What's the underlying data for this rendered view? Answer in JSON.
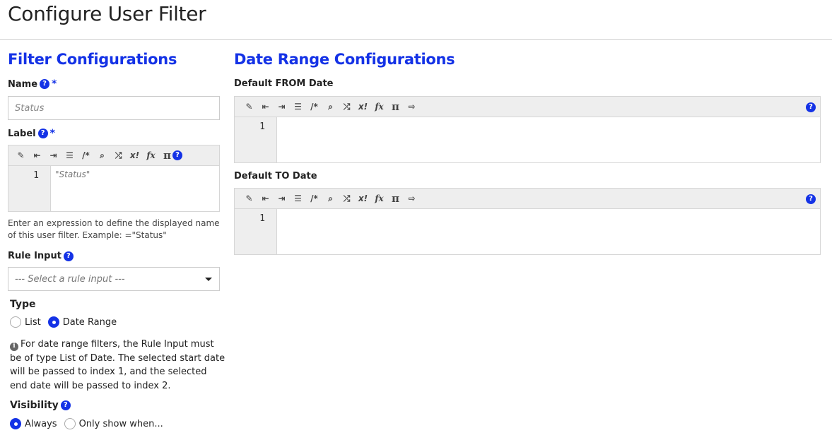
{
  "page": {
    "title": "Configure User Filter"
  },
  "filter_config": {
    "heading": "Filter Configurations",
    "name": {
      "label": "Name",
      "required_mark": "*",
      "placeholder": "Status",
      "value": ""
    },
    "label": {
      "label": "Label",
      "required_mark": "*",
      "line_number": "1",
      "code": "\"Status\"",
      "hint": "Enter an expression to define the displayed name of this user filter. Example: =\"Status\""
    },
    "rule_input": {
      "label": "Rule Input",
      "selected": "--- Select a rule input ---"
    },
    "type": {
      "label": "Type",
      "options": [
        {
          "label": "List",
          "selected": false
        },
        {
          "label": "Date Range",
          "selected": true
        }
      ],
      "info": "For date range filters, the Rule Input must be of type List of Date. The selected start date will be passed to index 1, and the selected end date will be passed to index 2."
    },
    "visibility": {
      "label": "Visibility",
      "options": [
        {
          "label": "Always",
          "selected": true
        },
        {
          "label": "Only show when...",
          "selected": false
        }
      ]
    }
  },
  "date_range_config": {
    "heading": "Date Range Configurations",
    "from": {
      "label": "Default FROM Date",
      "line_number": "1",
      "code": ""
    },
    "to": {
      "label": "Default TO Date",
      "line_number": "1",
      "code": ""
    }
  },
  "toolbar": {
    "buttons": [
      {
        "name": "format-wand-icon",
        "glyph": "🪄"
      },
      {
        "name": "outdent-icon",
        "glyph": "⇤"
      },
      {
        "name": "indent-icon",
        "glyph": "⇥"
      },
      {
        "name": "align-icon",
        "glyph": "☰"
      },
      {
        "name": "comment-icon",
        "glyph": "/*"
      },
      {
        "name": "search-icon",
        "glyph": "🔍"
      },
      {
        "name": "shuffle-icon",
        "glyph": "⤮"
      },
      {
        "name": "exception-icon",
        "glyph": "x!"
      },
      {
        "name": "function-icon",
        "glyph": "fx"
      },
      {
        "name": "constant-pi-icon",
        "glyph": "π"
      },
      {
        "name": "rule-input-icon",
        "glyph": "⇨"
      }
    ]
  },
  "colors": {
    "accent": "#1432e6"
  }
}
